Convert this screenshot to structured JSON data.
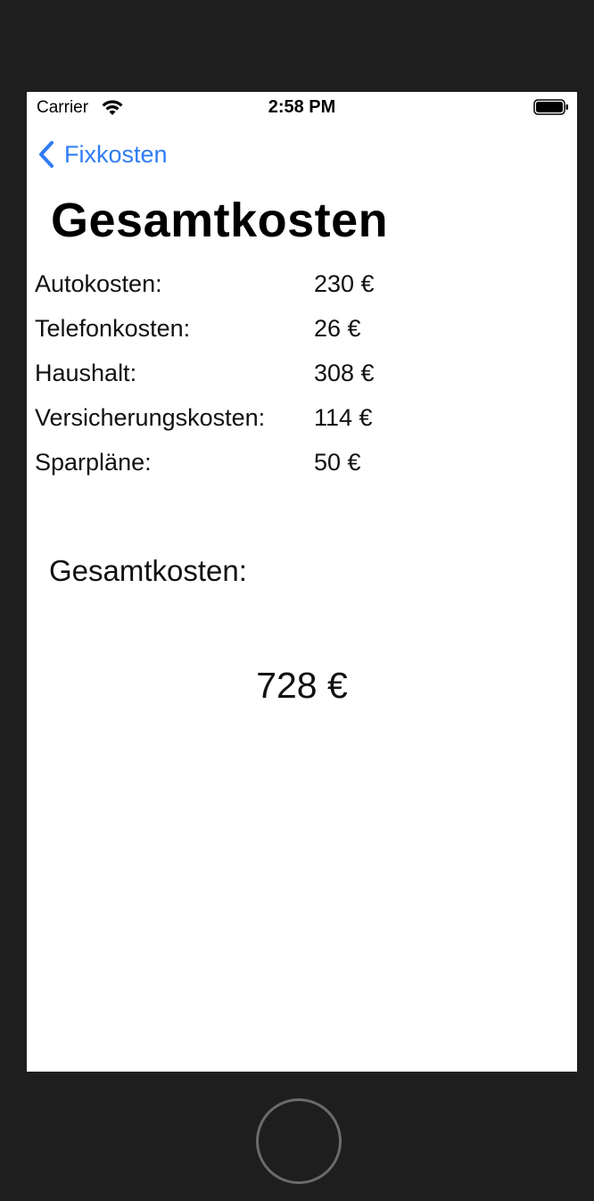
{
  "status_bar": {
    "carrier": "Carrier",
    "time": "2:58 PM",
    "wifi_icon": "wifi-icon",
    "battery_icon": "battery-icon"
  },
  "nav": {
    "back_label": "Fixkosten",
    "back_icon": "chevron-left-icon",
    "accent_color": "#2f7cf6"
  },
  "title": "Gesamtkosten",
  "costs": [
    {
      "label": "Autokosten:",
      "value": "230 €"
    },
    {
      "label": "Telefonkosten:",
      "value": "26 €"
    },
    {
      "label": "Haushalt:",
      "value": "308 €"
    },
    {
      "label": "Versicherungskosten:",
      "value": "114 €"
    },
    {
      "label": "Sparpläne:",
      "value": "50 €"
    }
  ],
  "total": {
    "label": "Gesamtkosten:",
    "value": "728 €"
  },
  "home_button_icon": "home-button-icon"
}
